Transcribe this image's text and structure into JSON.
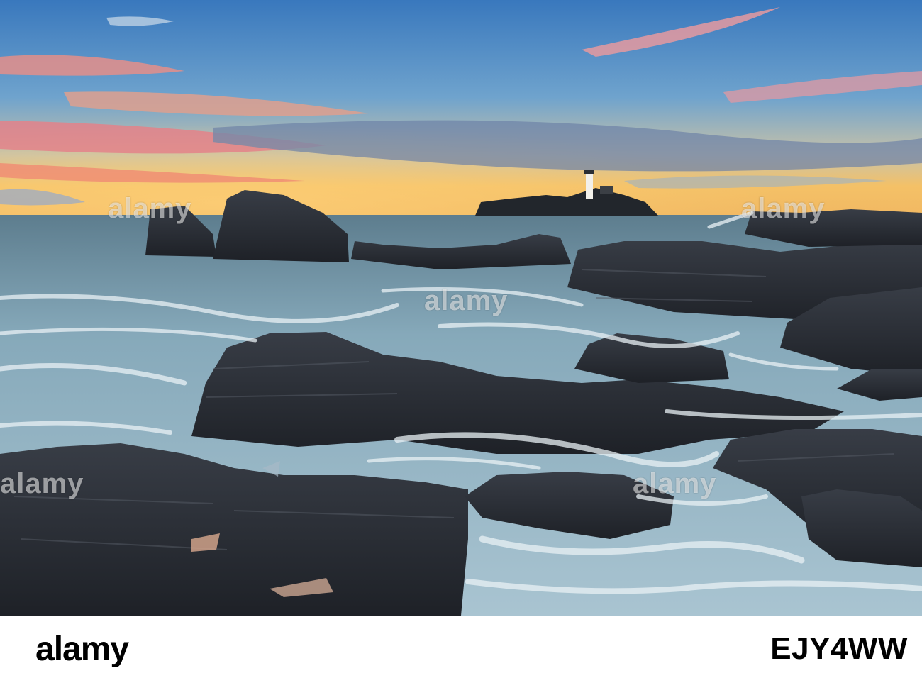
{
  "scene": {
    "subject": "lighthouse",
    "colors": {
      "sky_top": "#3d7fbf",
      "sky_glow": "#f6c565",
      "sea": "#6f97ab",
      "rock": "#262a31",
      "foam": "#dfe9ef"
    }
  },
  "watermarks": {
    "text": "alamy"
  },
  "footer": {
    "logo": "alamy",
    "image_id": "EJY4WW"
  }
}
